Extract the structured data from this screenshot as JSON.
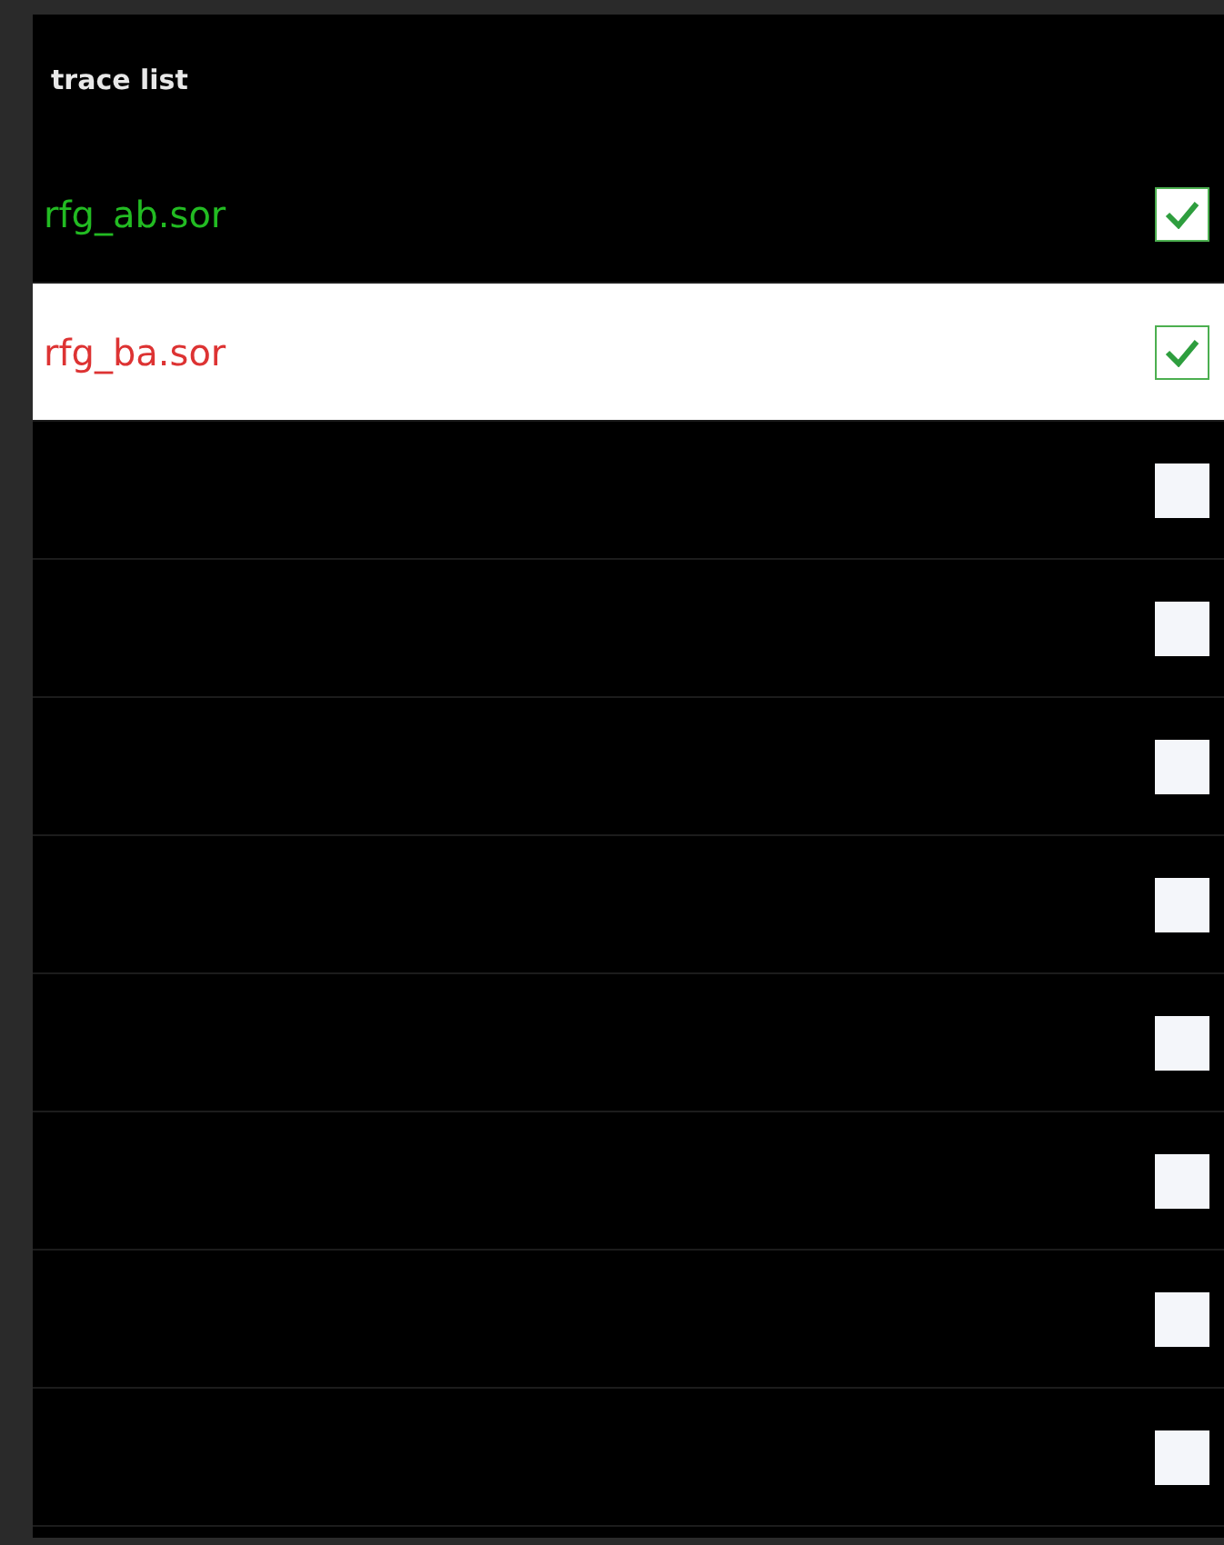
{
  "title": "trace list",
  "traces": [
    {
      "label": "rfg_ab.sor",
      "color": "#22bb22",
      "checked": true,
      "selected": false
    },
    {
      "label": "rfg_ba.sor",
      "color": "#dd3333",
      "checked": true,
      "selected": true
    },
    {
      "checked": false,
      "selected": false
    },
    {
      "checked": false,
      "selected": false
    },
    {
      "checked": false,
      "selected": false
    },
    {
      "checked": false,
      "selected": false
    },
    {
      "checked": false,
      "selected": false
    },
    {
      "checked": false,
      "selected": false
    },
    {
      "checked": false,
      "selected": false
    },
    {
      "checked": false,
      "selected": false
    }
  ]
}
